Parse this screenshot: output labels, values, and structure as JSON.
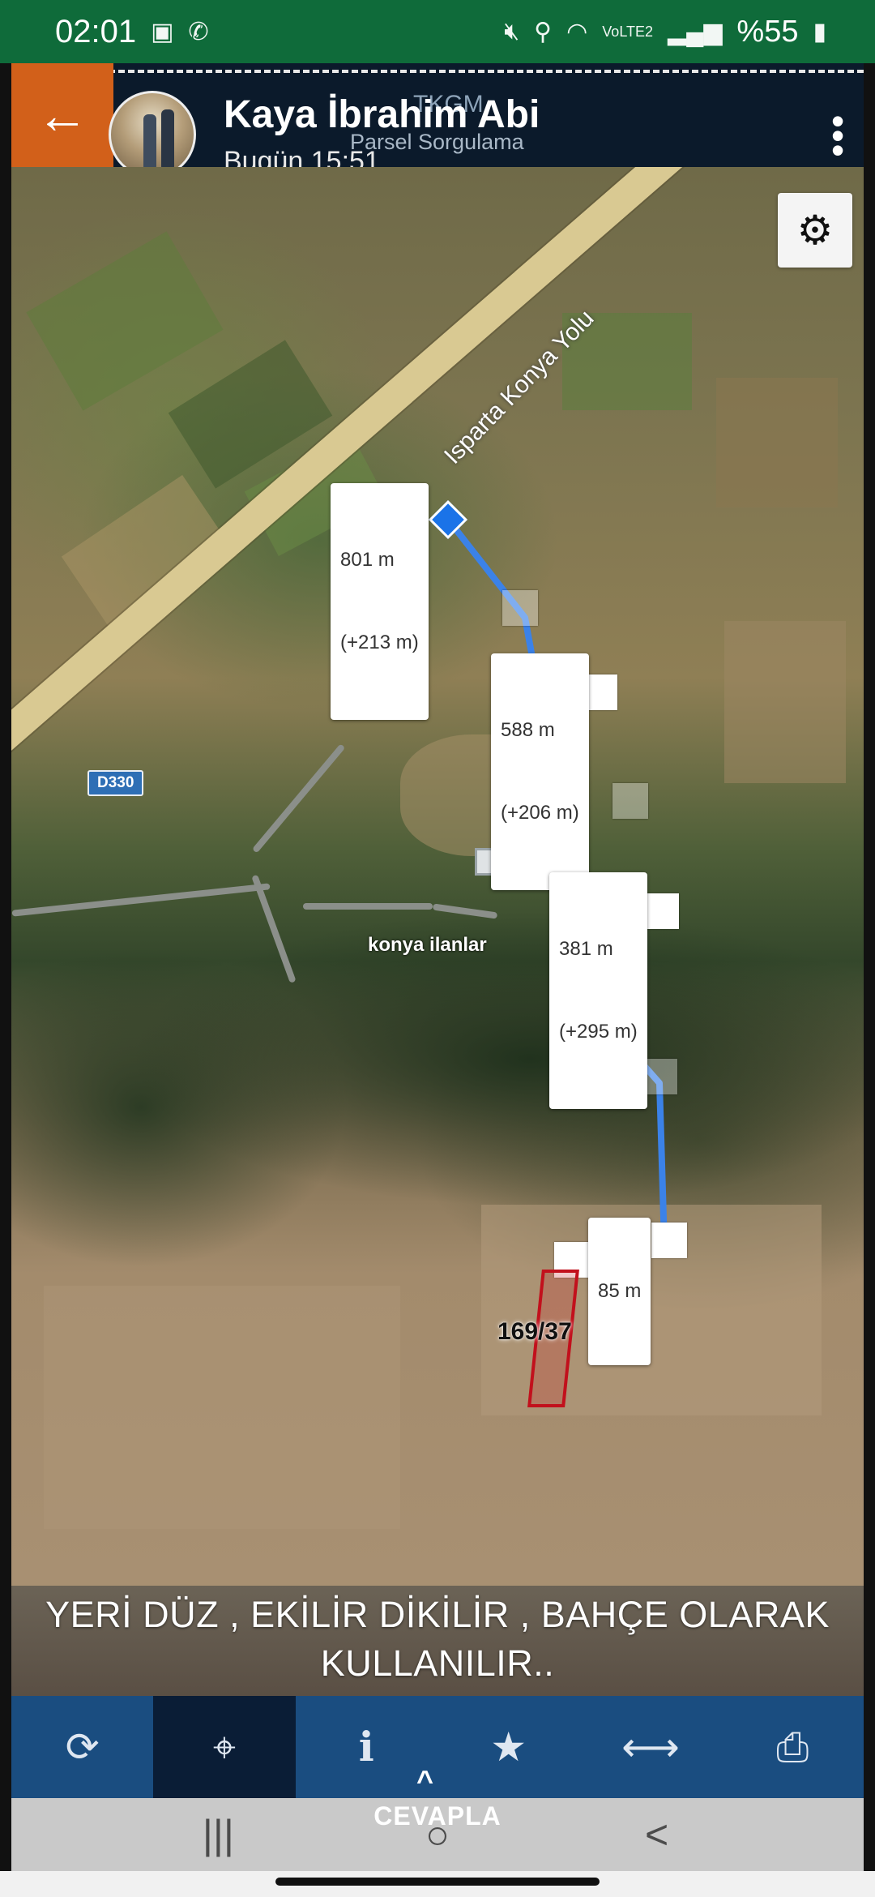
{
  "status_bar": {
    "time": "02:01",
    "left_icons": [
      "image-icon",
      "phone-icon"
    ],
    "right_icons": [
      "mute-icon",
      "location-icon",
      "wifi-icon",
      "signal-icon"
    ],
    "network": "VoLTE2",
    "battery": "%55"
  },
  "header": {
    "contact_name": "Kaya İbrahim Abi",
    "timestamp": "Bugün 15:51",
    "app_title": "TKGM",
    "app_subtitle": "Parsel Sorgulama",
    "back_icon": "arrow-left-icon",
    "more_icon": "more-vert-icon"
  },
  "map": {
    "road_label": "Isparta Konya Yolu",
    "road_shield": "D330",
    "watermark": "konya ilanlar",
    "parcel": "169/37",
    "settings_icon": "gear-icon",
    "measurements": [
      {
        "distance": "801 m",
        "delta": "(+213 m)"
      },
      {
        "distance": "588 m",
        "delta": "(+206 m)"
      },
      {
        "distance": "381 m",
        "delta": "(+295 m)"
      },
      {
        "distance": "85 m",
        "delta": ""
      }
    ]
  },
  "caption": {
    "line1": "YERİ DÜZ , EKİLİR DİKİLİR , BAHÇE OLARAK",
    "line2": "KULLANILIR.."
  },
  "toolbar": {
    "items": [
      {
        "icon": "refresh-icon",
        "glyph": "⟳",
        "active": false
      },
      {
        "icon": "crosshair-icon",
        "glyph": "⌖",
        "active": true
      },
      {
        "icon": "info-icon",
        "glyph": "ℹ",
        "active": false
      },
      {
        "icon": "star-icon",
        "glyph": "★",
        "active": false
      },
      {
        "icon": "measure-icon",
        "glyph": "⟷",
        "active": false
      },
      {
        "icon": "print-icon",
        "glyph": "⎙",
        "active": false
      }
    ]
  },
  "reply": {
    "label": "CEVAPLA",
    "chevron": "^"
  },
  "nav_bar": {
    "recents": "|||",
    "home": "○",
    "back": "<"
  },
  "colors": {
    "status_bar": "#0f6b3a",
    "header": "#0b1a2b",
    "back_accent": "#d2601a",
    "route": "#3b82e8",
    "parcel_outline": "#c2101c",
    "toolbar": "#1a4d80"
  }
}
